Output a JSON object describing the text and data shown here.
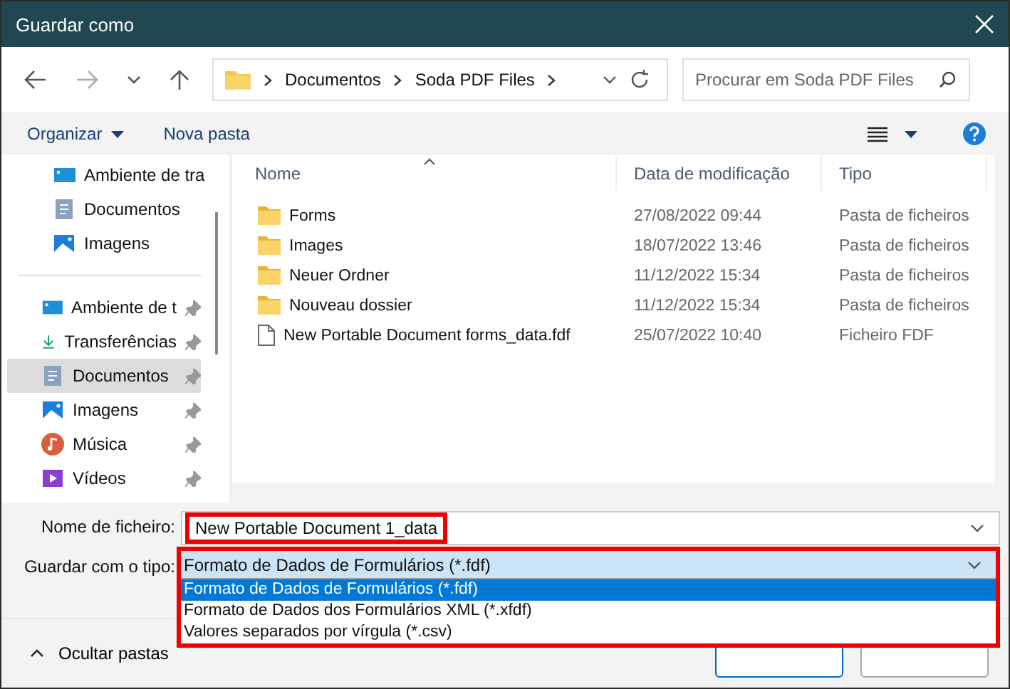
{
  "window": {
    "title": "Guardar como"
  },
  "address": {
    "segments": [
      "Documentos",
      "Soda PDF Files"
    ]
  },
  "search": {
    "placeholder": "Procurar em Soda PDF Files"
  },
  "toolbar": {
    "organize": "Organizar",
    "new_folder": "Nova pasta"
  },
  "sidebar": {
    "groups": [
      [
        {
          "label": "Ambiente de tra",
          "kind": "desktop",
          "pinned": false,
          "selected": false
        },
        {
          "label": "Documentos",
          "kind": "documents",
          "pinned": false,
          "selected": false
        },
        {
          "label": "Imagens",
          "kind": "pictures",
          "pinned": false,
          "selected": false
        }
      ],
      [
        {
          "label": "Ambiente de t",
          "kind": "desktop",
          "pinned": true,
          "selected": false
        },
        {
          "label": "Transferências",
          "kind": "downloads",
          "pinned": true,
          "selected": false
        },
        {
          "label": "Documentos",
          "kind": "documents",
          "pinned": true,
          "selected": true
        },
        {
          "label": "Imagens",
          "kind": "pictures",
          "pinned": true,
          "selected": false
        },
        {
          "label": "Música",
          "kind": "music",
          "pinned": true,
          "selected": false
        },
        {
          "label": "Vídeos",
          "kind": "videos",
          "pinned": true,
          "selected": false
        }
      ]
    ]
  },
  "table": {
    "columns": [
      "Nome",
      "Data de modificação",
      "Tipo"
    ],
    "rows": [
      {
        "kind": "folder",
        "name": "Forms",
        "date": "27/08/2022 09:44",
        "type": "Pasta de ficheiros"
      },
      {
        "kind": "folder",
        "name": "Images",
        "date": "18/07/2022 13:46",
        "type": "Pasta de ficheiros"
      },
      {
        "kind": "folder",
        "name": "Neuer Ordner",
        "date": "11/12/2022 15:34",
        "type": "Pasta de ficheiros"
      },
      {
        "kind": "folder",
        "name": "Nouveau dossier",
        "date": "11/12/2022 15:34",
        "type": "Pasta de ficheiros"
      },
      {
        "kind": "file",
        "name": "New Portable Document forms_data.fdf",
        "date": "25/07/2022 10:40",
        "type": "Ficheiro FDF"
      }
    ]
  },
  "filename": {
    "label": "Nome de ficheiro:",
    "value": "New Portable Document 1_data"
  },
  "filetype": {
    "label": "Guardar com o tipo:",
    "value": "Formato de Dados de Formulários (*.fdf)",
    "options": [
      {
        "label": "Formato de Dados de Formulários (*.fdf)",
        "selected": true
      },
      {
        "label": "Formato de Dados dos Formulários XML (*.xfdf)",
        "selected": false
      },
      {
        "label": "Valores separados por vírgula (*.csv)",
        "selected": false
      }
    ]
  },
  "footer": {
    "hide_folders": "Ocultar pastas"
  }
}
